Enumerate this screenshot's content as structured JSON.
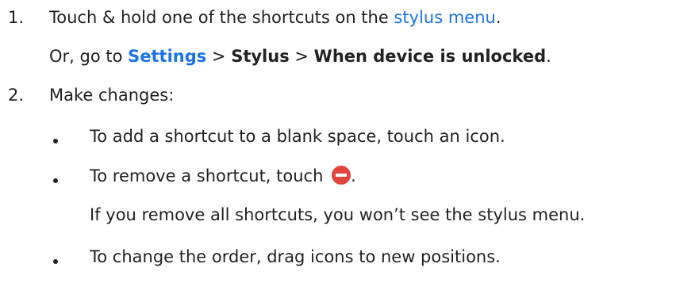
{
  "steps": [
    {
      "number": "1.",
      "text_before_link": "Touch & hold one of the shortcuts on the ",
      "link": "stylus menu",
      "text_after_link": ".",
      "alt": {
        "prefix": "Or, go to ",
        "settings": "Settings",
        "sep1": " > ",
        "stylus": "Stylus",
        "sep2": " > ",
        "unlocked": "When device is unlocked",
        "suffix": "."
      }
    },
    {
      "number": "2.",
      "text": "Make changes:",
      "bullets": [
        {
          "text": "To add a shortcut to a blank space, touch an icon."
        },
        {
          "text": "To remove a shortcut, touch ",
          "icon": "remove-icon",
          "suffix": ".",
          "note": "If you remove all shortcuts, you won’t see the stylus menu."
        },
        {
          "text": "To change the order, drag icons to new positions."
        }
      ]
    }
  ],
  "colors": {
    "link": "#1a73e8",
    "text": "#202124",
    "remove_icon": "#e2453c"
  }
}
